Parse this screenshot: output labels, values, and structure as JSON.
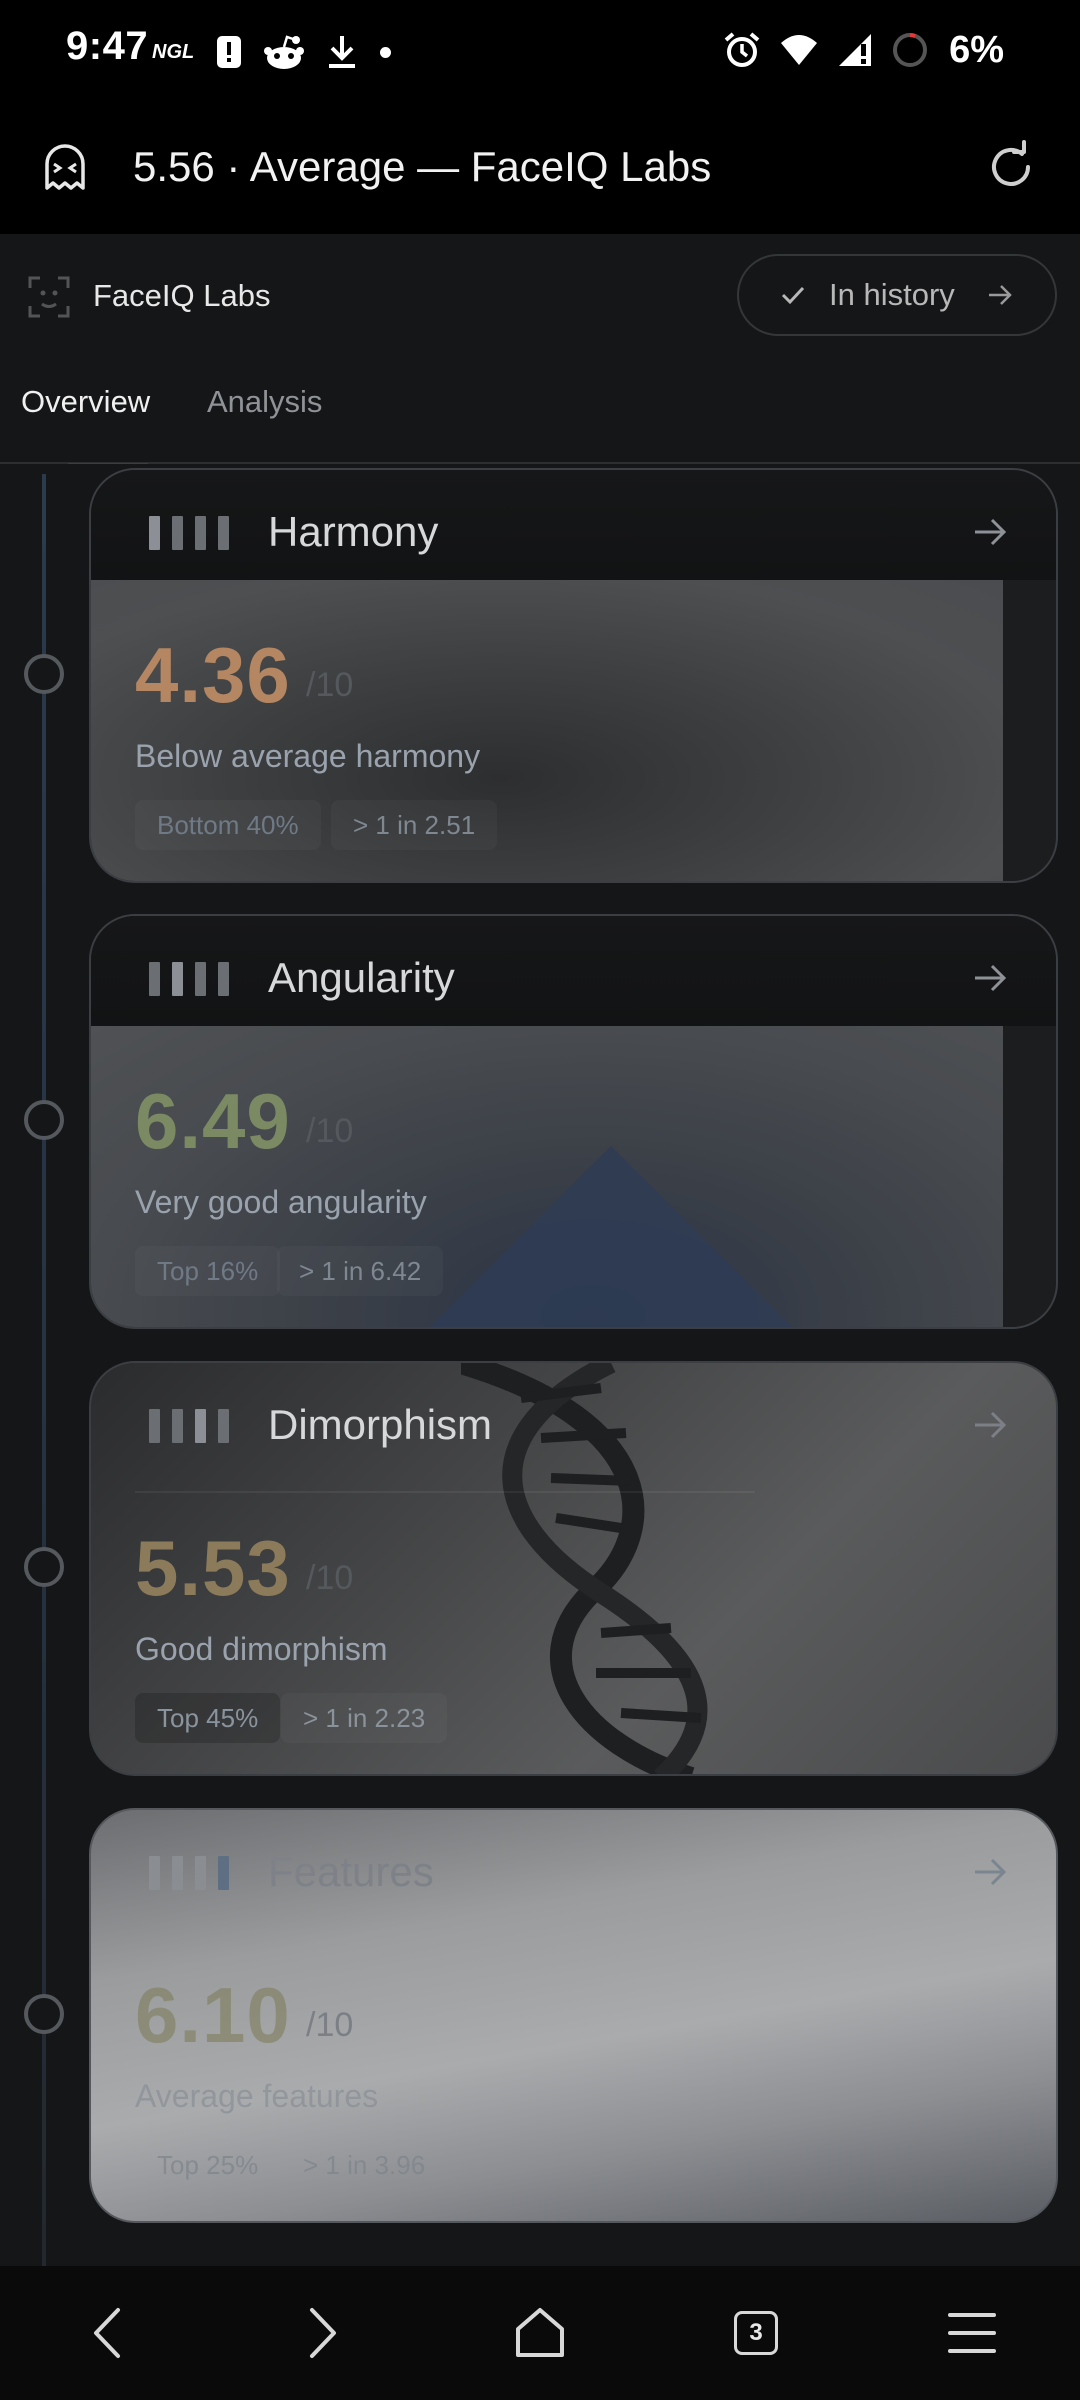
{
  "status_bar": {
    "time": "9:47",
    "ngl_label": "NGL",
    "battery_percent": "6%",
    "icons": [
      "ngl-icon",
      "alert-icon",
      "reddit-icon",
      "download-icon",
      "dot-icon",
      "alarm-icon",
      "wifi-icon",
      "signal-icon",
      "battery-icon"
    ]
  },
  "browser": {
    "title": "5.56 · Average — FaceIQ Labs",
    "site_icon": "ghost-face-icon",
    "reload_icon": "reload-icon"
  },
  "header": {
    "brand_name": "FaceIQ Labs",
    "history_label": "In history"
  },
  "tabs": [
    {
      "label": "Overview",
      "active": true
    },
    {
      "label": "Analysis",
      "active": false
    }
  ],
  "cards": [
    {
      "title": "Harmony",
      "score": "4.36",
      "max": "/10",
      "description": "Below average harmony",
      "rank": "Bottom 40%",
      "ratio": "> 1 in 2.51",
      "score_color": "#b48662"
    },
    {
      "title": "Angularity",
      "score": "6.49",
      "max": "/10",
      "description": "Very good angularity",
      "rank": "Top 16%",
      "ratio": "> 1 in 6.42",
      "score_color": "#7c8a64"
    },
    {
      "title": "Dimorphism",
      "score": "5.53",
      "max": "/10",
      "description": "Good dimorphism",
      "rank": "Top 45%",
      "ratio": "> 1 in 2.23",
      "score_color": "#8c7b5a"
    },
    {
      "title": "Features",
      "score": "6.10",
      "max": "/10",
      "description": "Average features",
      "rank": "Top 25%",
      "ratio": "> 1 in 3.96",
      "score_color": "#7d7a55"
    }
  ],
  "nav": {
    "tab_count": "3",
    "icons": [
      "back-icon",
      "forward-icon",
      "home-icon",
      "tabs-icon",
      "menu-icon"
    ]
  }
}
